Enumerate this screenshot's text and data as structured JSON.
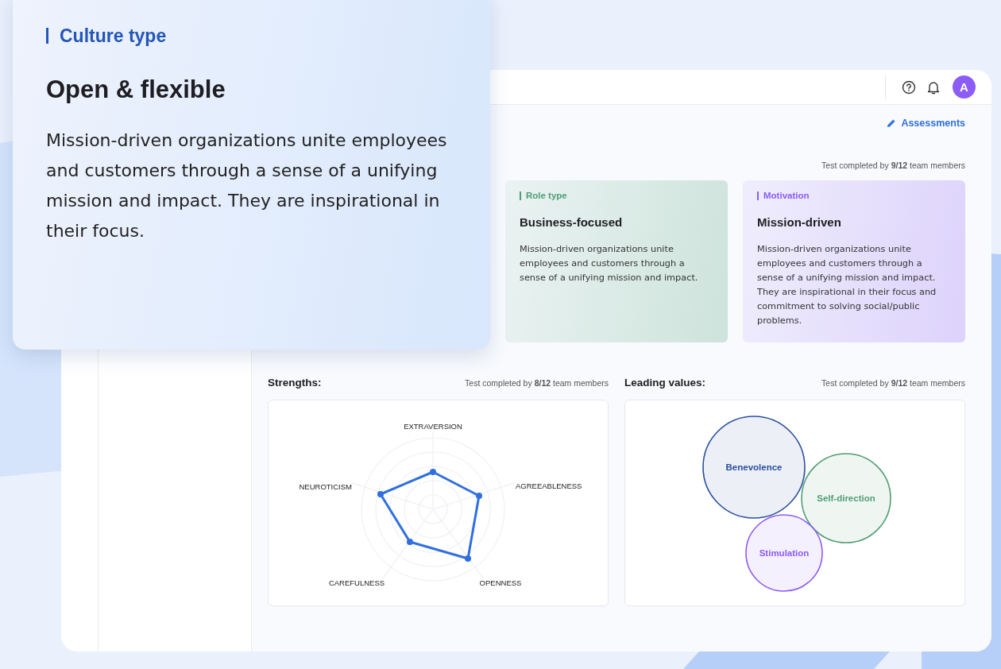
{
  "overlay": {
    "label": "Culture type",
    "title": "Open & flexible",
    "text": "Mission-driven organizations unite employees and customers through a sense of a unifying mission and impact. They are inspirational in their focus."
  },
  "header": {
    "avatar": "A"
  },
  "assessments_link": "Assessments",
  "profile": {
    "completion": "Test completed by **9/12** team members",
    "cards": [
      {
        "label": "Role type",
        "title": "Business-focused",
        "text": "Mission-driven organizations unite employees and customers through a sense of a unifying mission and impact.",
        "color": "#4d9e75"
      },
      {
        "label": "Motivation",
        "title": "Mission-driven",
        "text": "Mission-driven organizations unite employees and customers through a sense of a unifying mission and impact. They are inspirational in their focus and commitment to solving social/public problems.",
        "color": "#8b5cf6"
      }
    ]
  },
  "strengths": {
    "title": "Strengths:",
    "completion": "Test completed by **8/12** team members",
    "axes": [
      "EXTRAVERSION",
      "AGREEABLENESS",
      "OPENNESS",
      "CAREFULNESS",
      "NEUROTICISM"
    ]
  },
  "leading_values": {
    "title": "Leading values:",
    "completion": "Test completed by **9/12** team members",
    "values": [
      {
        "label": "Benevolence",
        "color": "#2a4f9e"
      },
      {
        "label": "Self-direction",
        "color": "#4f9e73"
      },
      {
        "label": "Stimulation",
        "color": "#8b5cf6"
      }
    ]
  }
}
